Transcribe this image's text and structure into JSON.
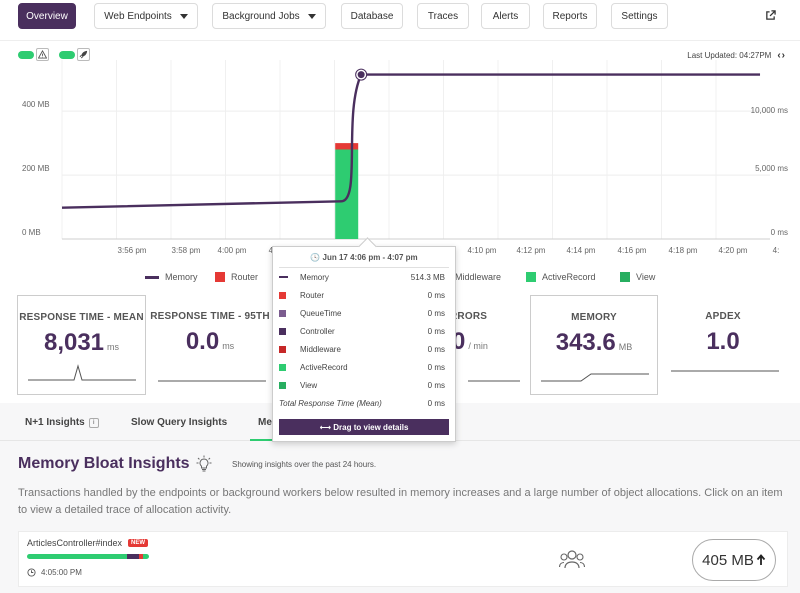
{
  "nav": {
    "items": [
      {
        "label": "Overview",
        "active": true,
        "dropdown": false
      },
      {
        "label": "Web Endpoints",
        "active": false,
        "dropdown": true
      },
      {
        "label": "Background Jobs",
        "active": false,
        "dropdown": true
      },
      {
        "label": "Database",
        "active": false,
        "dropdown": false
      },
      {
        "label": "Traces",
        "active": false,
        "dropdown": false
      },
      {
        "label": "Alerts",
        "active": false,
        "dropdown": false
      },
      {
        "label": "Reports",
        "active": false,
        "dropdown": false
      },
      {
        "label": "Settings",
        "active": false,
        "dropdown": false
      }
    ],
    "external_icon": "external-link-icon"
  },
  "toolbar": {
    "toggles": [
      {
        "icon": "warning-triangle-icon",
        "on": true
      },
      {
        "icon": "rocket-icon",
        "on": true
      }
    ],
    "last_updated": "Last Updated: 04:27PM",
    "nav_arrows": "‹›"
  },
  "colors": {
    "accent": "#4a2f5e",
    "router": "#e53935",
    "queuetime": "#7b5c8f",
    "controller": "#4a2f5e",
    "middleware": "#c62828",
    "activerecord": "#2ecc71",
    "view": "#27ae60"
  },
  "chart_data": {
    "type": "line",
    "y_left_ticks": [
      "400 MB",
      "200 MB",
      "0 MB"
    ],
    "y_right_ticks": [
      "10,000 ms",
      "5,000 ms",
      "0 ms"
    ],
    "x_ticks": [
      "3:56 pm",
      "3:58 pm",
      "4:00 pm",
      "4:",
      "4:10 pm",
      "4:12 pm",
      "4:14 pm",
      "4:16 pm",
      "4:18 pm",
      "4:20 pm",
      "4:"
    ],
    "memory_series": {
      "name": "Memory",
      "unit": "MB",
      "points": [
        {
          "t": "3:52 pm",
          "v": 98
        },
        {
          "t": "4:06 pm",
          "v": 118
        },
        {
          "t": "4:07 pm",
          "v": 514.3
        },
        {
          "t": "4:27 pm",
          "v": 514.3
        }
      ]
    },
    "response_bar": {
      "t": "4:06 pm",
      "unit": "ms",
      "stack": [
        {
          "name": "View",
          "value": 7000,
          "color": "#2ecc71"
        },
        {
          "name": "Router",
          "value": 500,
          "color": "#e53935"
        }
      ]
    },
    "highlight_point": {
      "t": "4:07 pm",
      "v": 514.3
    },
    "grid": true
  },
  "legend": [
    {
      "name": "Memory",
      "type": "line",
      "color": "#4a2f5e"
    },
    {
      "name": "Router",
      "type": "box",
      "color": "#e53935"
    },
    {
      "name": "Middleware",
      "type": "box",
      "color": "#c62828"
    },
    {
      "name": "ActiveRecord",
      "type": "box",
      "color": "#2ecc71"
    },
    {
      "name": "View",
      "type": "box",
      "color": "#27ae60"
    }
  ],
  "stats": {
    "response_mean": {
      "label": "RESPONSE TIME - MEAN",
      "value": "8,031",
      "unit": "ms"
    },
    "response_95": {
      "label": "RESPONSE TIME - 95TH",
      "value": "0.0",
      "unit": "ms"
    },
    "errors": {
      "label": "RRORS",
      "value": "0",
      "unit": "/ min"
    },
    "memory": {
      "label": "MEMORY",
      "value": "343.6",
      "unit": "MB"
    },
    "apdex": {
      "label": "APDEX",
      "value": "1.0"
    }
  },
  "tooltip": {
    "header": "Jun 17 4:06 pm - 4:07 pm",
    "rows": [
      {
        "label": "Memory",
        "value": "514.3 MB",
        "color": "#4a2f5e",
        "line": true
      },
      {
        "label": "Router",
        "value": "0 ms",
        "color": "#e53935"
      },
      {
        "label": "QueueTime",
        "value": "0 ms",
        "color": "#7b5c8f"
      },
      {
        "label": "Controller",
        "value": "0 ms",
        "color": "#4a2f5e"
      },
      {
        "label": "Middleware",
        "value": "0 ms",
        "color": "#c62828"
      },
      {
        "label": "ActiveRecord",
        "value": "0 ms",
        "color": "#2ecc71"
      },
      {
        "label": "View",
        "value": "0 ms",
        "color": "#27ae60"
      }
    ],
    "total_label": "Total Response Time (Mean)",
    "total_value": "0 ms",
    "drag_label": "⟷ Drag to view details"
  },
  "insights_tabs": [
    {
      "label": "N+1 Insights",
      "icon": "info-icon"
    },
    {
      "label": "Slow Query Insights"
    },
    {
      "label": "Me",
      "active": true
    }
  ],
  "memory_bloat": {
    "title": "Memory Bloat Insights",
    "subtitle": "Showing insights over the past 24 hours.",
    "description": "Transactions handled by the endpoints or background workers below resulted in memory increases and a large number of object allocations. Click on an item to view a detailed trace of allocation activity.",
    "rows": [
      {
        "name": "ArticlesController#index",
        "badge": "NEW",
        "time": "4:05:00 PM",
        "size": "405 MB",
        "bar": [
          {
            "color": "#2ecc71",
            "fraction": 0.82
          },
          {
            "color": "#4a2f5e",
            "fraction": 0.1
          },
          {
            "color": "#e53935",
            "fraction": 0.03
          },
          {
            "color": "#2ecc71",
            "fraction": 0.05
          }
        ]
      }
    ]
  }
}
